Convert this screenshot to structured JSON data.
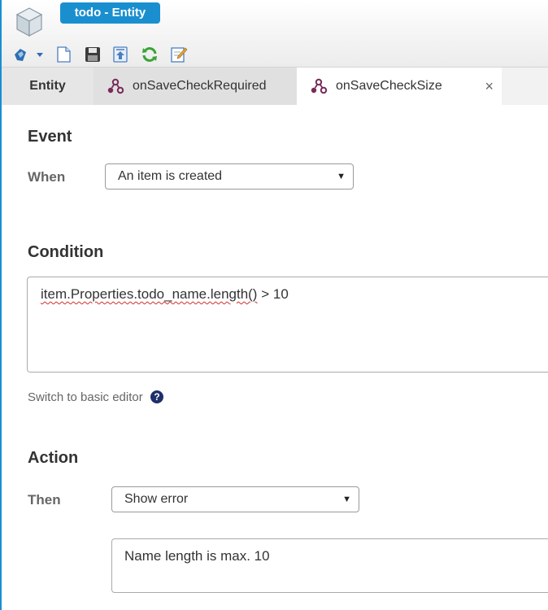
{
  "window": {
    "title": "todo - Entity"
  },
  "toolbar": {
    "items": [
      "actions-icon",
      "new-icon",
      "save-icon",
      "publish-icon",
      "refresh-icon",
      "edit-icon"
    ]
  },
  "tabs": [
    {
      "label": "Entity"
    },
    {
      "label": "onSaveCheckRequired"
    },
    {
      "label": "onSaveCheckSize",
      "close": "×"
    }
  ],
  "event": {
    "title": "Event",
    "when_label": "When",
    "when_value": "An item is created"
  },
  "condition": {
    "title": "Condition",
    "code_underlined": "item.Properties.todo_name.length()",
    "code_rest": " > 10",
    "switch_link": "Switch to basic editor",
    "help": "?"
  },
  "action": {
    "title": "Action",
    "then_label": "Then",
    "then_value": "Show error",
    "message": "Name length is max. 10"
  },
  "colors": {
    "accent": "#1a8fd0",
    "rule_icon": "#7a2a5a"
  }
}
